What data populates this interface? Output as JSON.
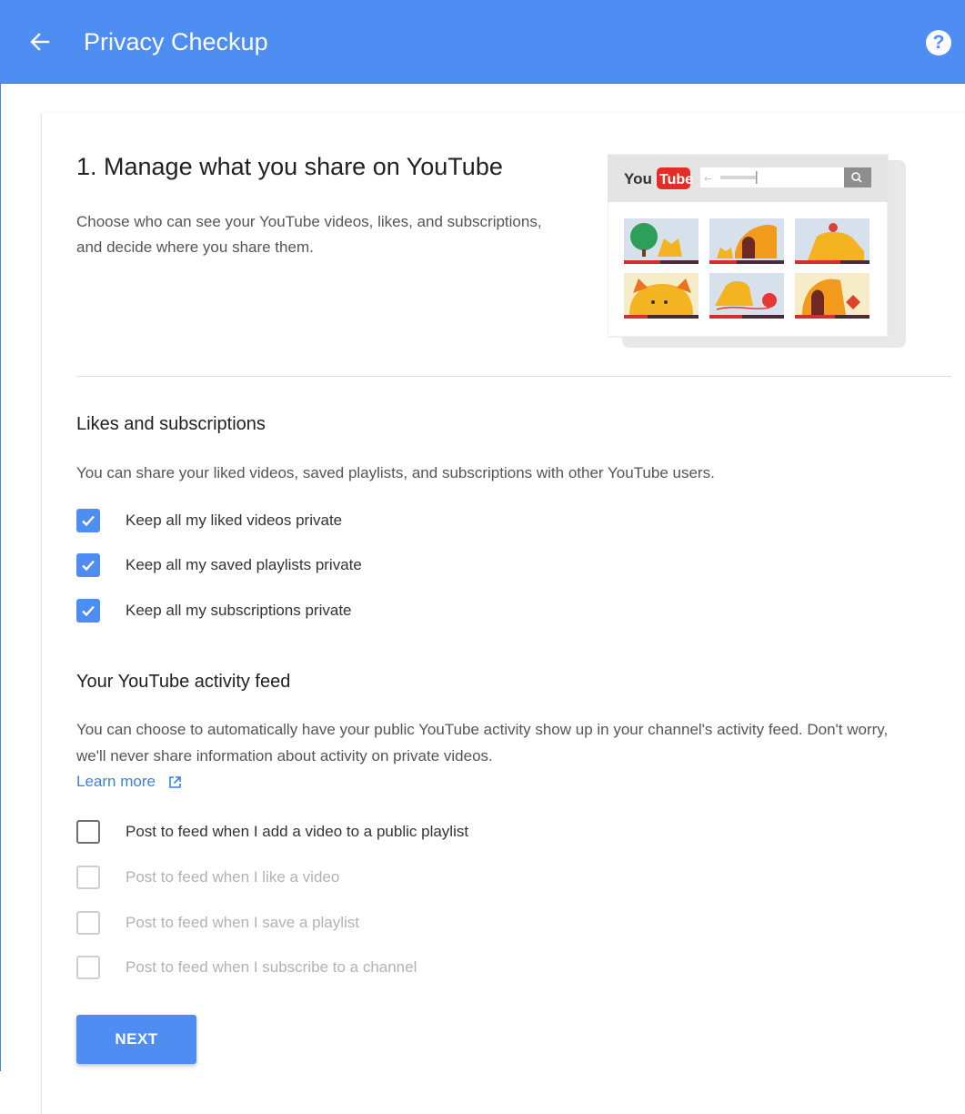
{
  "appbar": {
    "title": "Privacy Checkup",
    "back_icon": "arrow-left-icon",
    "help_label": "?"
  },
  "intro": {
    "title": "1. Manage what you share on YouTube",
    "description": "Choose who can see your YouTube videos, likes, and subscriptions, and decide where you share them.",
    "illustration": {
      "logo_you": "You",
      "logo_tube": "Tube"
    }
  },
  "likes": {
    "heading": "Likes and subscriptions",
    "description": "You can share your liked videos, saved playlists, and subscriptions with other YouTube users.",
    "options": [
      {
        "label": "Keep all my liked videos private",
        "checked": true
      },
      {
        "label": "Keep all my saved playlists private",
        "checked": true
      },
      {
        "label": "Keep all my subscriptions private",
        "checked": true
      }
    ]
  },
  "feed": {
    "heading": "Your YouTube activity feed",
    "description": "You can choose to automatically have your public YouTube activity show up in your channel's activity feed. Don't worry, we'll never share information about activity on private videos.",
    "learn_more": "Learn more",
    "options": [
      {
        "label": "Post to feed when I add a video to a public playlist",
        "checked": false,
        "disabled": false
      },
      {
        "label": "Post to feed when I like a video",
        "checked": false,
        "disabled": true
      },
      {
        "label": "Post to feed when I save a playlist",
        "checked": false,
        "disabled": true
      },
      {
        "label": "Post to feed when I subscribe to a channel",
        "checked": false,
        "disabled": true
      }
    ]
  },
  "next_button": "NEXT",
  "colors": {
    "primary": "#4e8df1",
    "link": "#3f7fe4",
    "youtube_red": "#e52d27"
  }
}
